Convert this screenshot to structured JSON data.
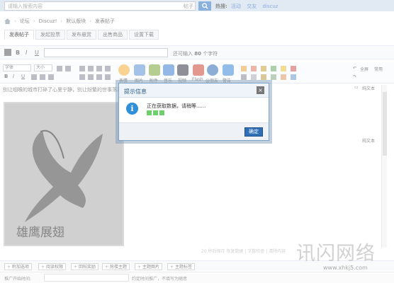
{
  "search": {
    "placeholder": "请输入搜索内容",
    "scope": "帖子",
    "hot_label": "热搜:",
    "hot_links": [
      "活动",
      "交友",
      "discuz"
    ]
  },
  "breadcrumb": [
    "论坛",
    "Discuz!",
    "默认版块",
    "发表帖子"
  ],
  "tabs": [
    "发表帖子",
    "发起投票",
    "发布悬赏",
    "出售商品",
    "设置下载"
  ],
  "title_bar": {
    "hint_prefix": "还可输入",
    "hint_count": "80",
    "hint_suffix": "个字符",
    "bold": "B",
    "italic": "I",
    "underline": "U"
  },
  "toolbar": {
    "font_select": "字体",
    "size_select": "大小",
    "captions": [
      "表情",
      "图片",
      "附件",
      "音乐",
      "视频",
      "Flash",
      "@朋友",
      "警告"
    ],
    "right": [
      "全屏",
      "常用",
      "纯文本"
    ]
  },
  "editor": {
    "text": "别让咽喉的城市打碎了心里宁静，别让纷繁的世事落满你的心，……拿一本书吧，那自己"
  },
  "status_line": "20 秒后保存  恢复数据  | 字数检查  | 清除内容",
  "bottom_buttons": [
    "附加选项",
    "阅读权限",
    "回帖奖励",
    "抢楼主题",
    "主题图片",
    "主题标签"
  ],
  "info_row": {
    "label": "推广开始时间:",
    "hint": "约定时间推广，不填写为随意"
  },
  "dialog": {
    "title": "提示信息",
    "message": "正在获取数据，请稍等......",
    "ok": "确定"
  },
  "watermark": {
    "main": "讯闪网络",
    "url": "www.xhkj5.com"
  },
  "colors": {
    "accent": "#2e6fb8",
    "loader": "#6dd06d",
    "info_icon": "#2f8fd8"
  }
}
